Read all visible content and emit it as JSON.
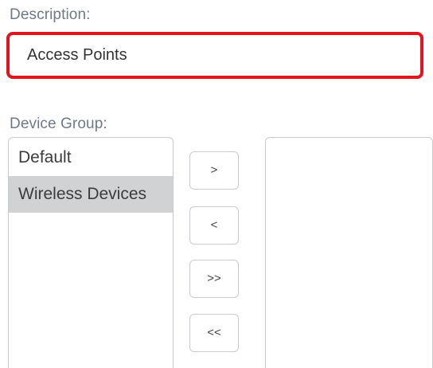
{
  "description": {
    "label": "Description:",
    "value": "Access Points",
    "highlight_color": "#e3141b"
  },
  "device_group": {
    "label": "Device Group:",
    "available": [
      {
        "label": "Default",
        "selected": false
      },
      {
        "label": "Wireless Devices",
        "selected": true
      }
    ],
    "selected_items": [],
    "buttons": {
      "move_right": ">",
      "move_left": "<",
      "move_all_right": ">>",
      "move_all_left": "<<"
    }
  }
}
